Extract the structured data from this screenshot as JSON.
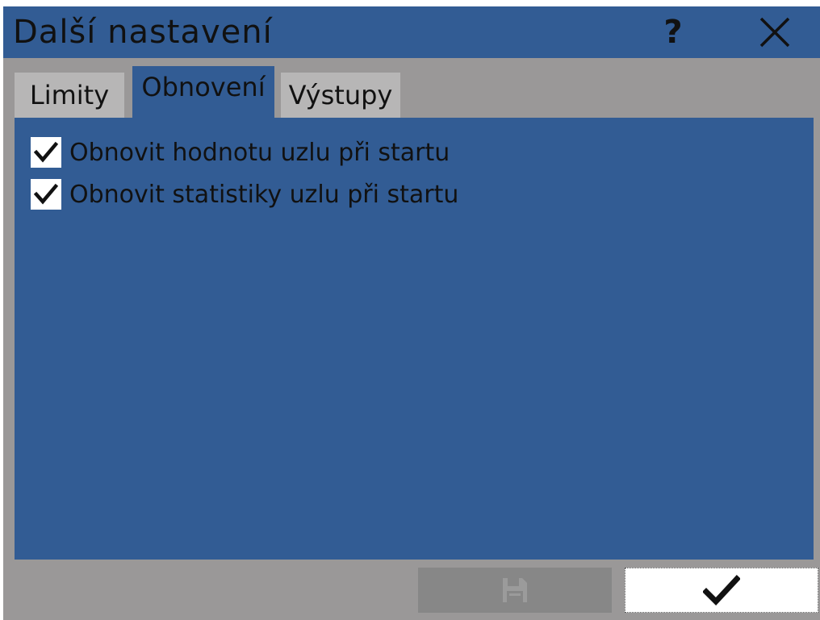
{
  "dialog": {
    "title": "Další nastavení",
    "help_label": "?",
    "close_icon": "close-icon",
    "colors": {
      "titlebar": "#325c94",
      "frame": "#9a9898",
      "inactive_tab": "#b7b6b6",
      "panel": "#325c94"
    }
  },
  "tabs": [
    {
      "label": "Limity",
      "active": false
    },
    {
      "label": "Obnovení",
      "active": true
    },
    {
      "label": "Výstupy",
      "active": false
    }
  ],
  "options": [
    {
      "label": "Obnovit hodnotu uzlu při startu",
      "checked": true
    },
    {
      "label": "Obnovit statistiky uzlu při startu",
      "checked": true
    }
  ],
  "footer": {
    "save_icon": "save-icon",
    "save_enabled": false,
    "ok_icon": "checkmark-icon"
  }
}
